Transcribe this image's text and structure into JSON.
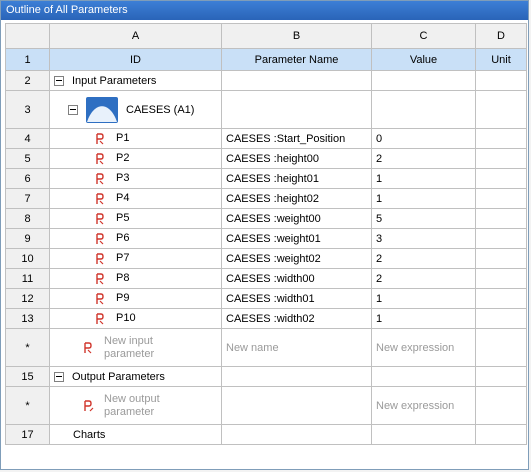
{
  "panel_title": "Outline of All Parameters",
  "columns": {
    "a": "A",
    "b": "B",
    "c": "C",
    "d": "D"
  },
  "headers": {
    "id": "ID",
    "name": "Parameter Name",
    "value": "Value",
    "unit": "Unit"
  },
  "row_numbers": {
    "r1": "1",
    "r2": "2",
    "r3": "3",
    "r15": "15",
    "r17": "17",
    "star": "*"
  },
  "input_group": "Input Parameters",
  "system_label": "CAESES (A1)",
  "params": [
    {
      "row": "4",
      "id": "P1",
      "name": "CAESES :Start_Position",
      "value": "0"
    },
    {
      "row": "5",
      "id": "P2",
      "name": "CAESES :height00",
      "value": "2"
    },
    {
      "row": "6",
      "id": "P3",
      "name": "CAESES :height01",
      "value": "1"
    },
    {
      "row": "7",
      "id": "P4",
      "name": "CAESES :height02",
      "value": "1"
    },
    {
      "row": "8",
      "id": "P5",
      "name": "CAESES :weight00",
      "value": "5"
    },
    {
      "row": "9",
      "id": "P6",
      "name": "CAESES :weight01",
      "value": "3"
    },
    {
      "row": "10",
      "id": "P7",
      "name": "CAESES :weight02",
      "value": "2"
    },
    {
      "row": "11",
      "id": "P8",
      "name": "CAESES :width00",
      "value": "2"
    },
    {
      "row": "12",
      "id": "P9",
      "name": "CAESES :width01",
      "value": "1"
    },
    {
      "row": "13",
      "id": "P10",
      "name": "CAESES :width02",
      "value": "1"
    }
  ],
  "new_input": {
    "line1": "New input",
    "line2": "parameter",
    "name": "New name",
    "expression": "New expression"
  },
  "output_group": "Output Parameters",
  "new_output": {
    "line1": "New output",
    "line2": "parameter",
    "expression": "New expression"
  },
  "charts": "Charts",
  "colors": {
    "title_bar": "#2f6cc4",
    "header_row": "#c9e0f7",
    "param_icon": "#d0352b"
  }
}
